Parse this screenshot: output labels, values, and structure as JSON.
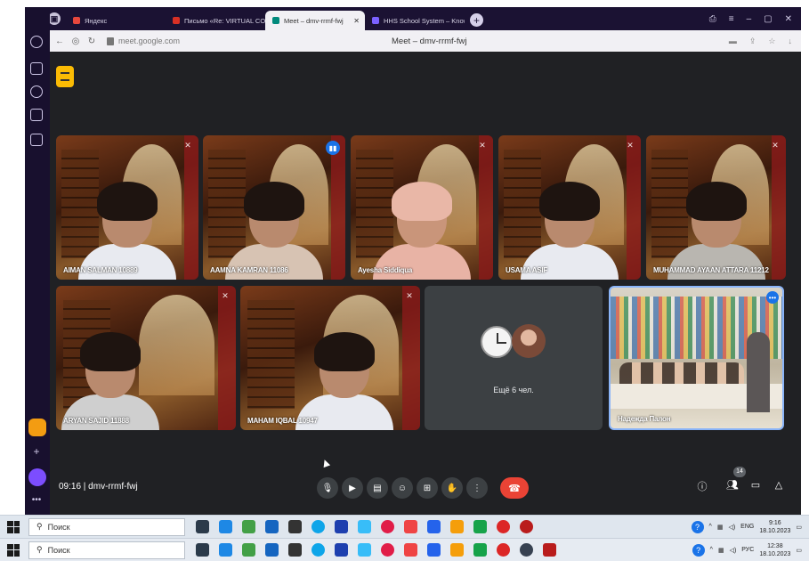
{
  "browser": {
    "tabs": [
      {
        "label": "Яндекс",
        "color": "#e8483d"
      },
      {
        "label": "Письмо «Re: VIRTUAL CO",
        "color": "#d93025"
      },
      {
        "label": "Meet – dmv-rrmf-fwj",
        "color": "#00897b",
        "active": true
      },
      {
        "label": "HHS School System – Know",
        "color": "#7b61ff"
      }
    ],
    "url": "meet.google.com",
    "page_title": "Meet – dmv-rrmf-fwj",
    "window_buttons": [
      "–",
      "▢",
      "✕"
    ]
  },
  "meet": {
    "participants": [
      {
        "name": "AIMAN SALMAN 10889",
        "muted": true
      },
      {
        "name": "AAMNA KAMRAN 11086",
        "speaking": true
      },
      {
        "name": "Ayesha Siddiqua",
        "muted": true
      },
      {
        "name": "USAMA ASIF",
        "muted": true
      },
      {
        "name": "MUHAMMAD AYAAN ATTARA 11212",
        "muted": true
      },
      {
        "name": "ARYAN SAJID 11888",
        "muted": true
      },
      {
        "name": "MAHAM IQBAL 10947",
        "muted": true
      },
      {
        "name": "Надежда Палон"
      }
    ],
    "more_label": "Ещё 6 чел.",
    "time": "09:16",
    "code": "dmv-rrmf-fwj",
    "time_and_code": "09:16 | dmv-rrmf-fwj",
    "people_count": "14"
  },
  "taskbar_top": {
    "search_placeholder": "Поиск",
    "lang": "ENG",
    "time": "9:16",
    "date": "18.10.2023"
  },
  "taskbar_bottom": {
    "search_placeholder": "Поиск",
    "lang": "РУС",
    "time": "12:38",
    "date": "18.10.2023"
  }
}
